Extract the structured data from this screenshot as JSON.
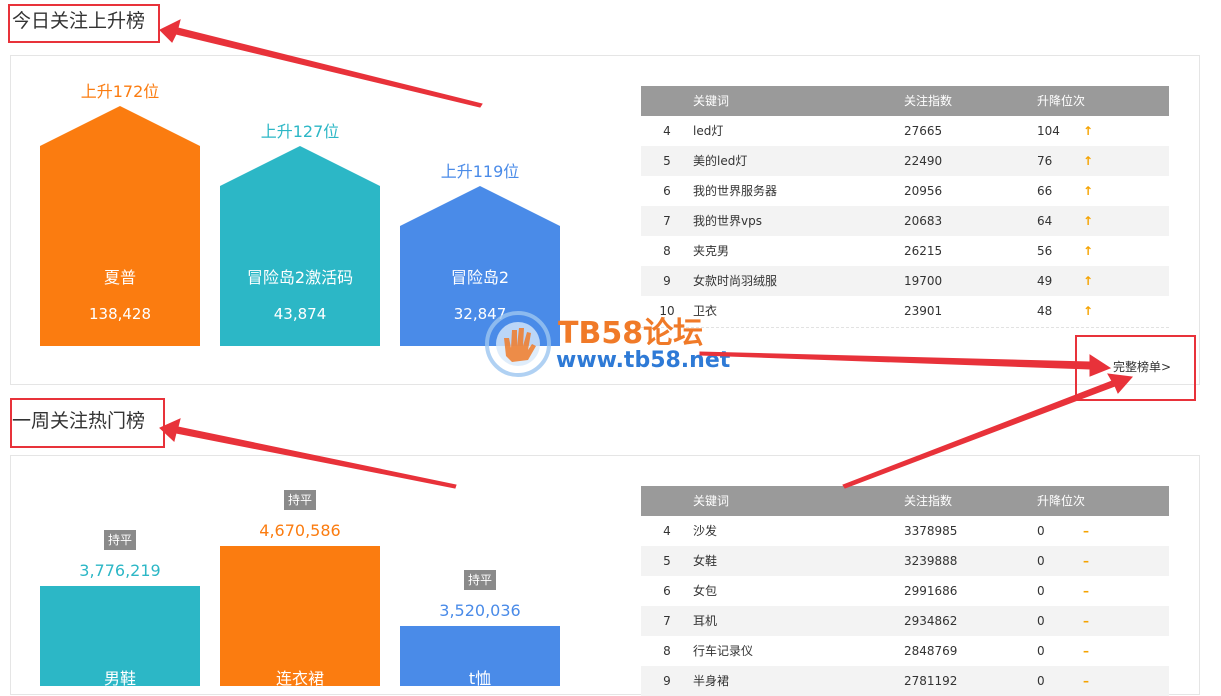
{
  "section1": {
    "title": "今日关注上升榜",
    "bars": [
      {
        "name": "夏普",
        "value": "138,428",
        "rise": "上升172位",
        "color": "#fb7c10"
      },
      {
        "name": "冒险岛2激活码",
        "value": "43,874",
        "rise": "上升127位",
        "color": "#2cb7c6"
      },
      {
        "name": "冒险岛2",
        "value": "32,847",
        "rise": "上升119位",
        "color": "#4a8be8"
      }
    ],
    "table": {
      "headers": [
        "关键词",
        "关注指数",
        "升降位次"
      ],
      "rows": [
        {
          "rank": "4",
          "keyword": "led灯",
          "index": "27665",
          "change": "104",
          "trend": "↑"
        },
        {
          "rank": "5",
          "keyword": "美的led灯",
          "index": "22490",
          "change": "76",
          "trend": "↑"
        },
        {
          "rank": "6",
          "keyword": "我的世界服务器",
          "index": "20956",
          "change": "66",
          "trend": "↑"
        },
        {
          "rank": "7",
          "keyword": "我的世界vps",
          "index": "20683",
          "change": "64",
          "trend": "↑"
        },
        {
          "rank": "8",
          "keyword": "夹克男",
          "index": "26215",
          "change": "56",
          "trend": "↑"
        },
        {
          "rank": "9",
          "keyword": "女款时尚羽绒服",
          "index": "19700",
          "change": "49",
          "trend": "↑"
        },
        {
          "rank": "10",
          "keyword": "卫衣",
          "index": "23901",
          "change": "48",
          "trend": "↑"
        }
      ]
    },
    "more_link": "完整榜单>"
  },
  "section2": {
    "title": "一周关注热门榜",
    "bars": [
      {
        "name": "男鞋",
        "value": "3,776,219",
        "badge": "持平",
        "color": "#2cb7c6"
      },
      {
        "name": "连衣裙",
        "value": "4,670,586",
        "badge": "持平",
        "color": "#fb7c10"
      },
      {
        "name": "t恤",
        "value": "3,520,036",
        "badge": "持平",
        "color": "#4a8be8"
      }
    ],
    "table": {
      "headers": [
        "关键词",
        "关注指数",
        "升降位次"
      ],
      "rows": [
        {
          "rank": "4",
          "keyword": "沙发",
          "index": "3378985",
          "change": "0",
          "trend": "–"
        },
        {
          "rank": "5",
          "keyword": "女鞋",
          "index": "3239888",
          "change": "0",
          "trend": "–"
        },
        {
          "rank": "6",
          "keyword": "女包",
          "index": "2991686",
          "change": "0",
          "trend": "–"
        },
        {
          "rank": "7",
          "keyword": "耳机",
          "index": "2934862",
          "change": "0",
          "trend": "–"
        },
        {
          "rank": "8",
          "keyword": "行车记录仪",
          "index": "2848769",
          "change": "0",
          "trend": "–"
        },
        {
          "rank": "9",
          "keyword": "半身裙",
          "index": "2781192",
          "change": "0",
          "trend": "–"
        }
      ]
    }
  },
  "watermark": {
    "line1": "TB58论坛",
    "line2": "www.tb58.net"
  }
}
